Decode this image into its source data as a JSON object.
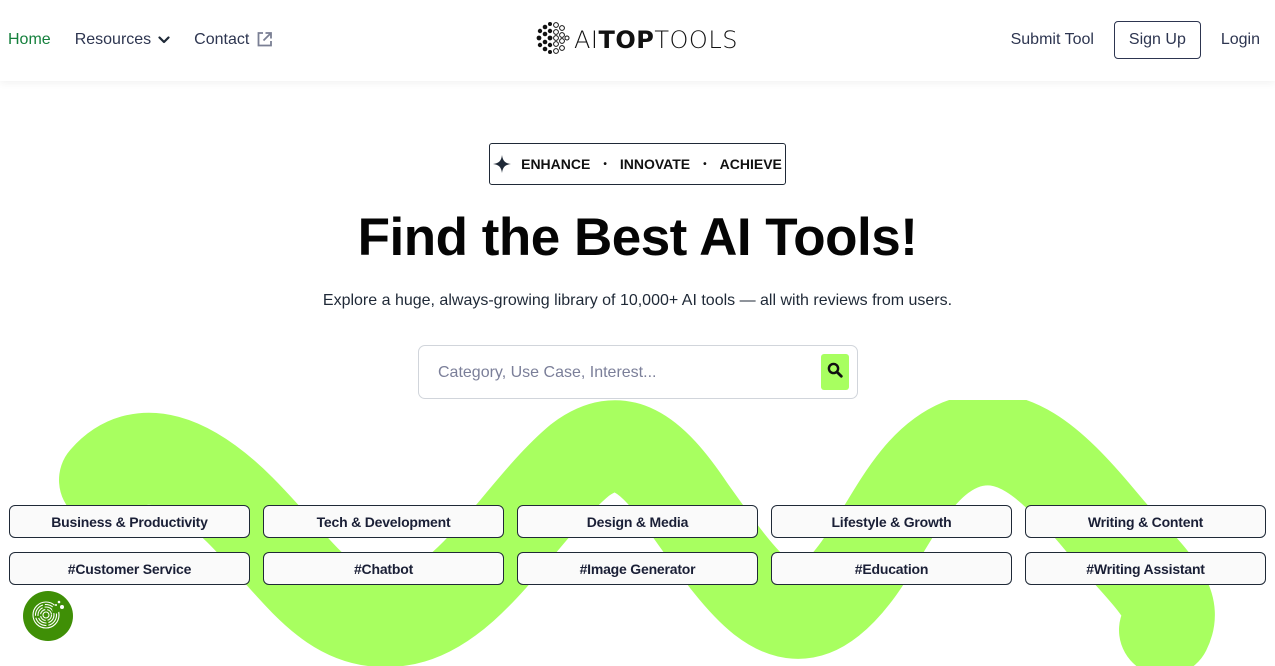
{
  "header": {
    "nav_left": [
      {
        "label": "Home",
        "active": true
      },
      {
        "label": "Resources",
        "icon": "chevron-down-icon"
      },
      {
        "label": "Contact",
        "icon": "external-link-icon"
      }
    ],
    "logo": {
      "prefix": "AI",
      "bold": "TOP",
      "suffix": "TOOLS",
      "icon": "neural-dots-icon"
    },
    "nav_right": {
      "submit_tool": "Submit Tool",
      "sign_up": "Sign Up",
      "login": "Login"
    }
  },
  "hero": {
    "tagline": {
      "icon": "sparkle-icon",
      "words": [
        "ENHANCE",
        "INNOVATE",
        "ACHIEVE"
      ],
      "separator": "•"
    },
    "title": "Find the Best AI Tools!",
    "subtitle": "Explore a huge, always-growing library of 10,000+ AI tools — all with reviews from users.",
    "search": {
      "placeholder": "Category, Use Case, Interest...",
      "value": "",
      "button_icon": "search-icon"
    }
  },
  "categories": [
    "Business & Productivity",
    "Tech & Development",
    "Design & Media",
    "Lifestyle & Growth",
    "Writing & Content"
  ],
  "hashtags": [
    "#Customer Service",
    "#Chatbot",
    "#Image Generator",
    "#Education",
    "#Writing Assistant"
  ],
  "colors": {
    "accent_green": "#a8ff60",
    "active_nav": "#15803d",
    "cookie_badge": "#3f8f06",
    "text_dark": "#1f2937"
  },
  "cookie_widget": {
    "icon": "cookie-fingerprint-icon"
  }
}
